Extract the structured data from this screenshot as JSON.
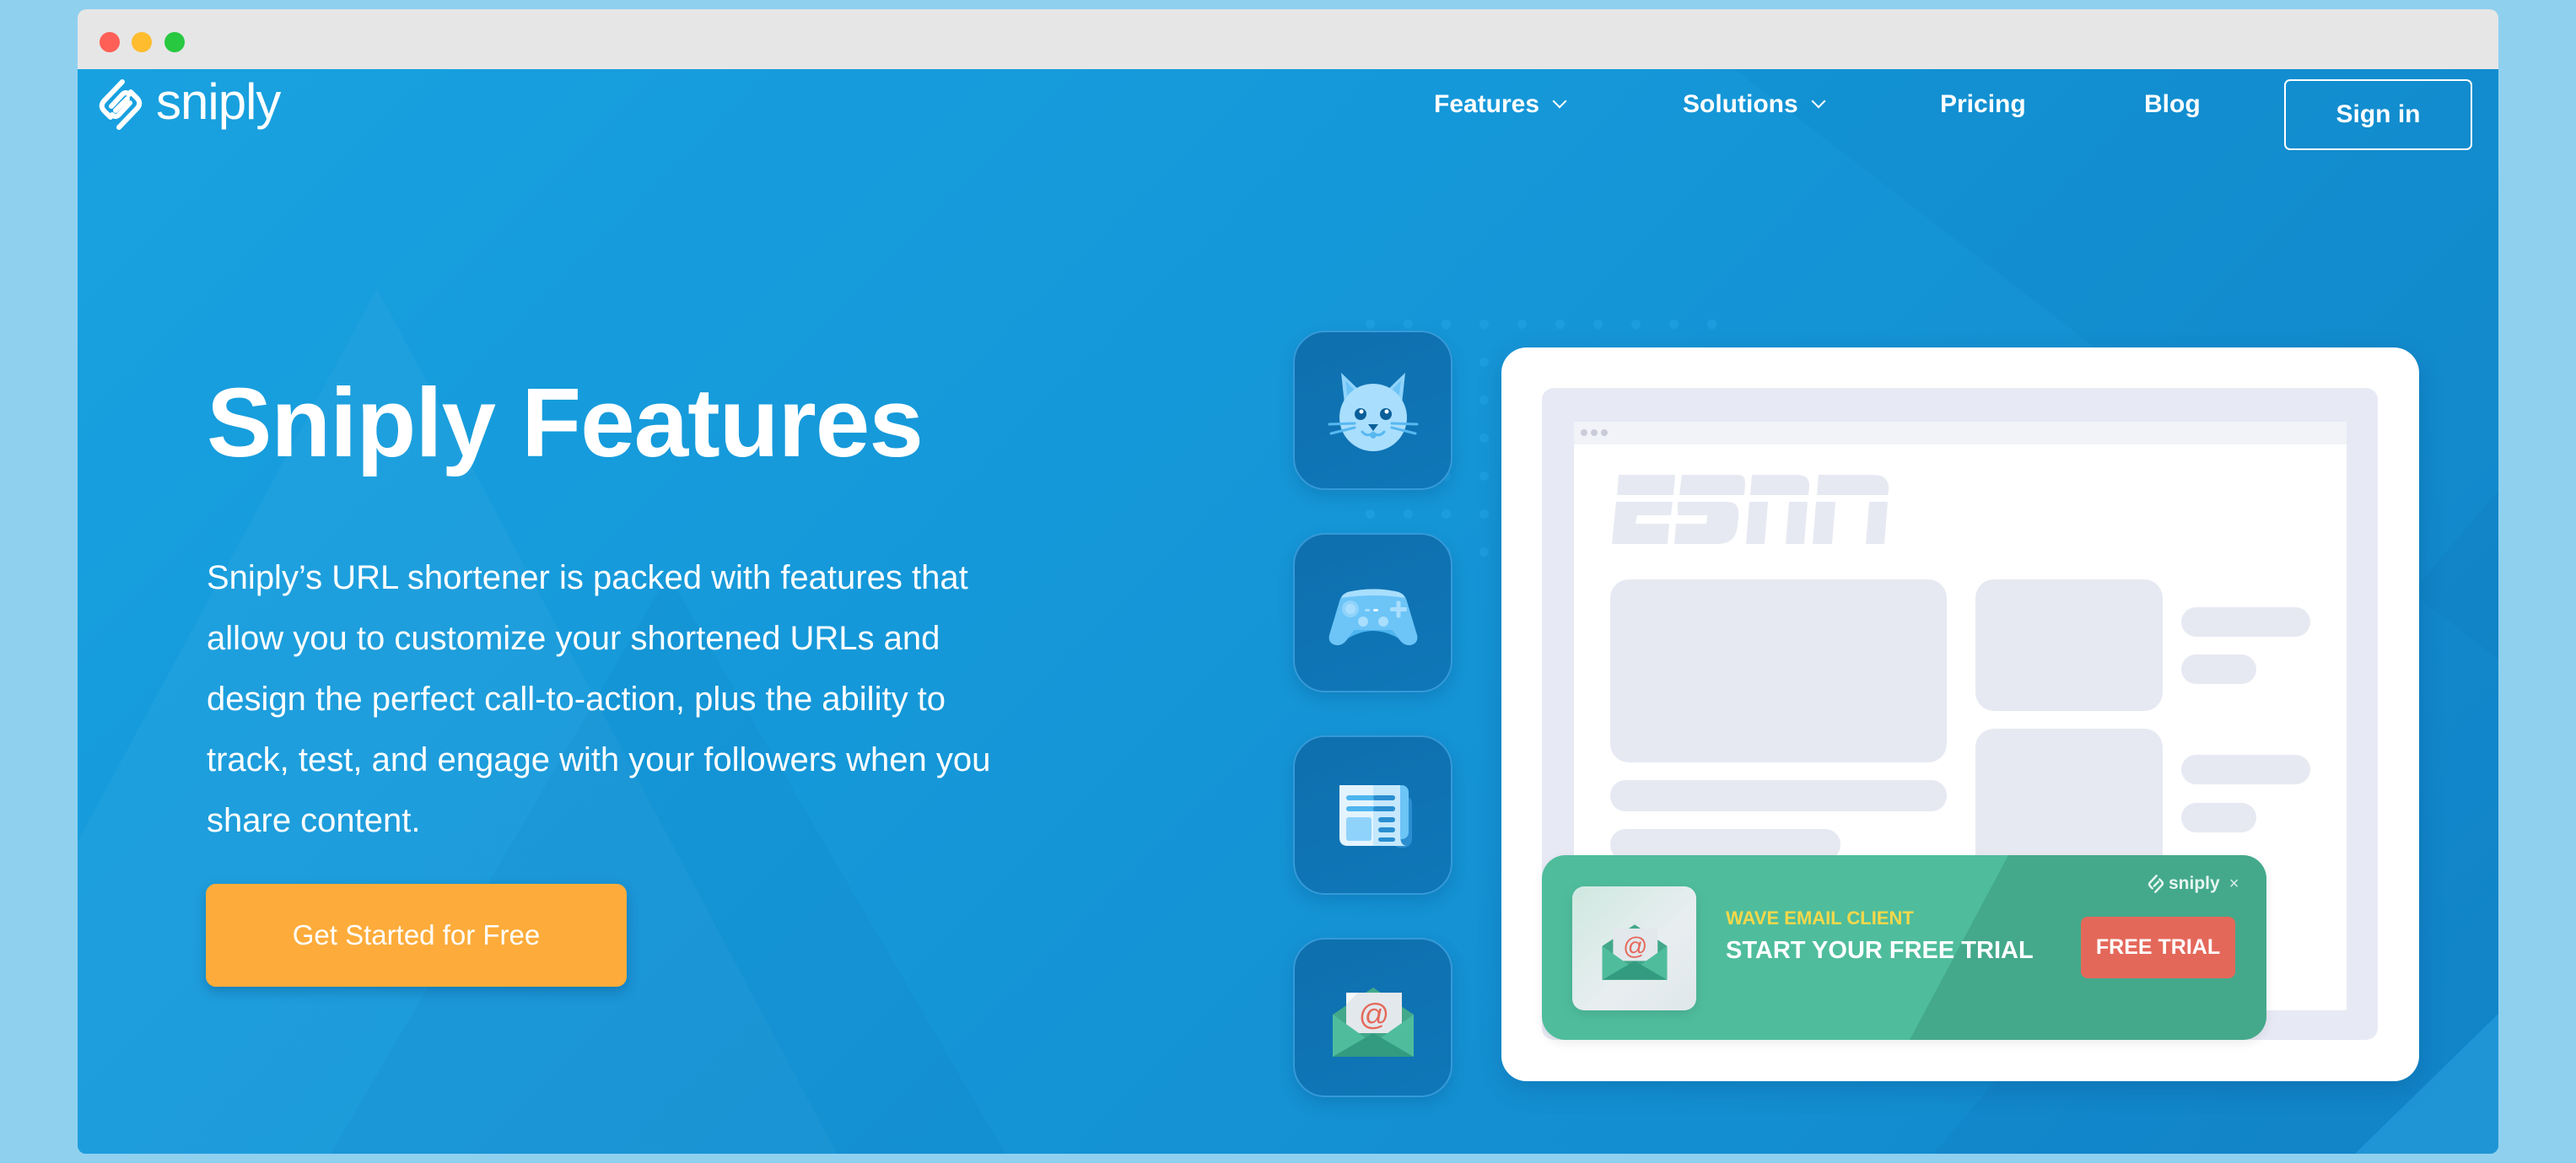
{
  "window": {
    "controls": [
      "close",
      "minimize",
      "zoom"
    ]
  },
  "brand": {
    "name": "sniply",
    "logo_icon": "sniply-link-logo-icon"
  },
  "nav": {
    "items": [
      {
        "label": "Features",
        "has_dropdown": true
      },
      {
        "label": "Solutions",
        "has_dropdown": true
      },
      {
        "label": "Pricing",
        "has_dropdown": false
      },
      {
        "label": "Blog",
        "has_dropdown": false
      }
    ],
    "signin_label": "Sign in"
  },
  "hero": {
    "title": "Sniply Features",
    "description_lines": [
      "Sniply’s URL shortener is packed with features that",
      "allow you to customize your shortened URLs and",
      "design the perfect call-to-action, plus the ability to",
      "track, test, and engage with your followers when you",
      "share content."
    ],
    "cta_label": "Get Started for Free"
  },
  "feature_icons": [
    "cat-icon",
    "gamepad-icon",
    "newspaper-icon",
    "email-envelope-icon"
  ],
  "mockup": {
    "site_logo_text": "ESPN",
    "banner": {
      "eyebrow": "WAVE EMAIL CLIENT",
      "title": "START YOUR FREE TRIAL",
      "cta_label": "FREE TRIAL",
      "brand": "sniply",
      "close_symbol": "×"
    }
  },
  "colors": {
    "page_bg": "#1592d6",
    "cta": "#fdac3b",
    "banner_green": "#4fbd9c",
    "banner_green_dark": "#44a98b",
    "banner_cta": "#e4685a",
    "eyebrow_yellow": "#f7d84a"
  }
}
